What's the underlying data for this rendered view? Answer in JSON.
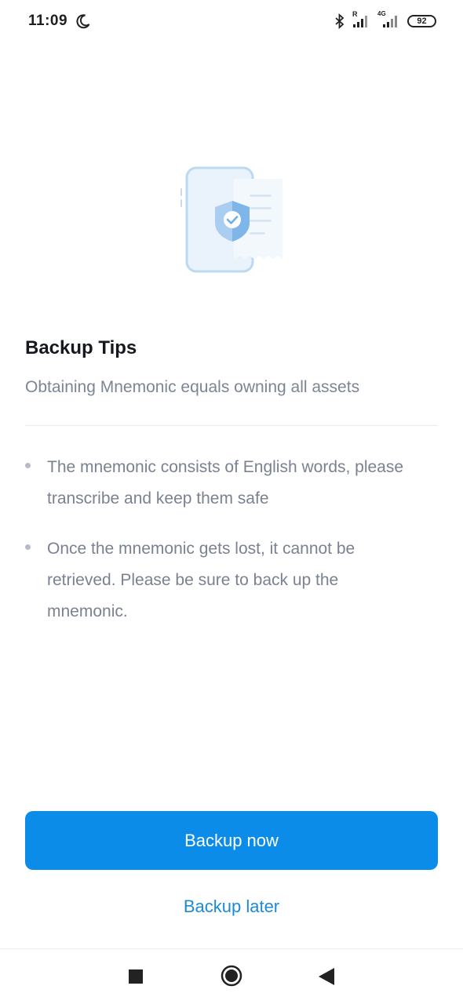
{
  "status_bar": {
    "time": "11:09",
    "network_type": "4G",
    "roaming_indicator": "R",
    "battery_level": "92",
    "icons": [
      "moon-icon",
      "bluetooth-icon",
      "signal-icon",
      "signal-4g-icon",
      "battery-icon"
    ]
  },
  "header": {
    "title": "Backup Tips",
    "subtitle": "Obtaining Mnemonic equals owning all assets"
  },
  "tips": [
    {
      "text": "The mnemonic consists of English words, please transcribe and keep them safe"
    },
    {
      "text": "Once the mnemonic gets lost, it cannot be retrieved. Please be sure to back up the mnemonic."
    }
  ],
  "actions": {
    "primary_label": "Backup now",
    "secondary_label": "Backup later"
  },
  "nav_bar": {
    "buttons": [
      "recents-square-icon",
      "home-circle-icon",
      "back-triangle-icon"
    ]
  },
  "colors": {
    "accent": "#0c8ce9",
    "link": "#1a8ad9",
    "title": "#15191f",
    "muted_text": "#7a8190",
    "divider": "#e8eaee"
  }
}
